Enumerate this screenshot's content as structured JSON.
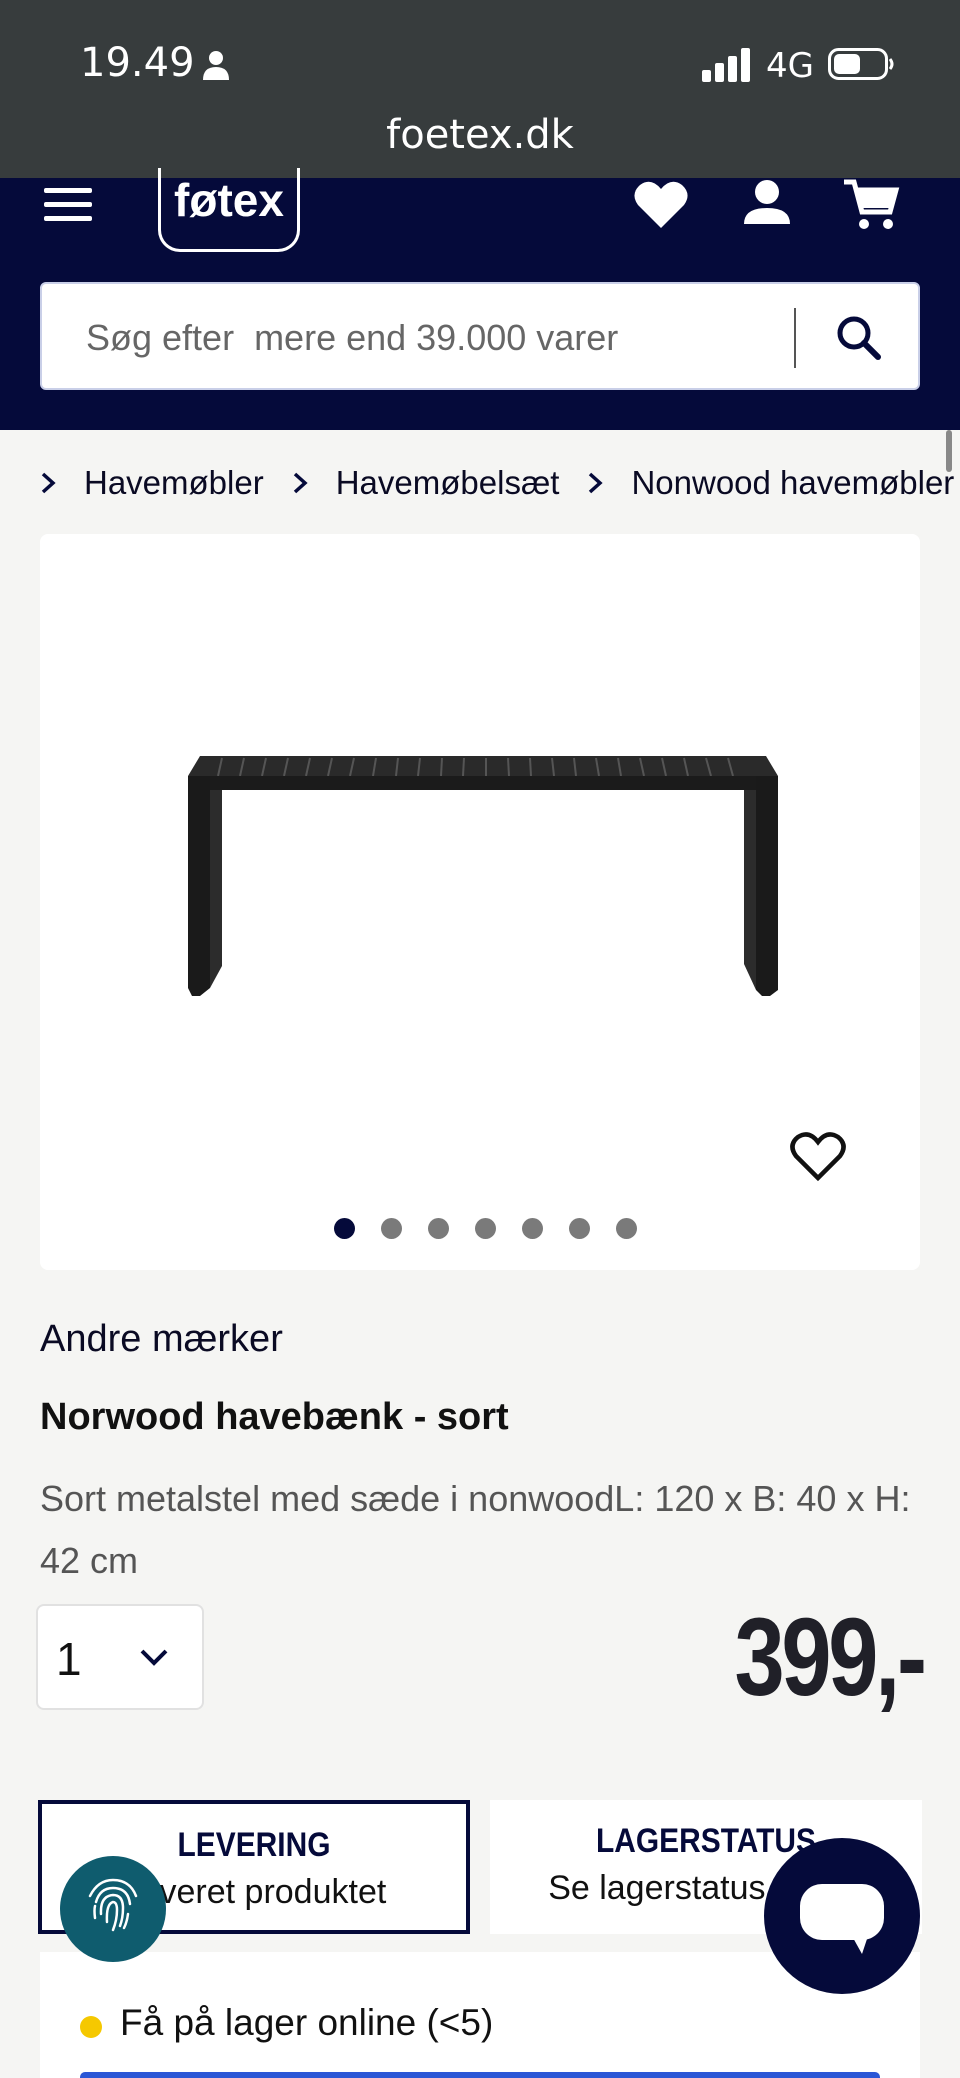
{
  "status_bar": {
    "time": "19.49",
    "network": "4G",
    "url": "foetex.dk"
  },
  "header": {
    "logo_text": "føtex",
    "search_placeholder": "Søg efter  mere end 39.000 varer",
    "icons": [
      "menu-icon",
      "heart-icon",
      "user-icon",
      "cart-icon",
      "search-icon"
    ],
    "brand_color": "#050a3a"
  },
  "breadcrumb": [
    "Havemøbler",
    "Havemøbelsæt",
    "Nonwood havemøbler"
  ],
  "gallery": {
    "dot_count": 7,
    "active_index": 0
  },
  "product": {
    "brand": "Andre mærker",
    "title": "Norwood havebænk - sort",
    "description": "Sort metalstel med sæde i nonwoodL: 120 x B: 40 x H: 42 cm",
    "quantity": "1",
    "price": "399,-"
  },
  "tabs": [
    {
      "title": "LEVERING",
      "subtitle": "Leveret produktet"
    },
    {
      "title": "LAGERSTATUS",
      "subtitle": "Se lagerstatus i butik"
    }
  ],
  "stock": {
    "text": "Få på lager online (<5)",
    "indicator_color": "#f5c800"
  }
}
